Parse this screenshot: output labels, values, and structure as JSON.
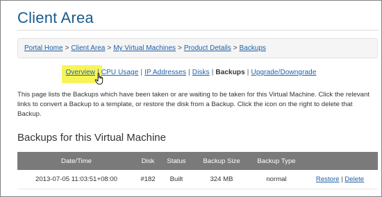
{
  "page_title": "Client Area",
  "breadcrumb": {
    "items": [
      "Portal Home",
      "Client Area",
      "My Virtual Machines",
      "Product Details",
      "Backups"
    ],
    "separator": ">"
  },
  "tabs": {
    "items": [
      "Overview",
      "CPU Usage",
      "IP Addresses",
      "Disks",
      "Backups",
      "Upgrade/Downgrade"
    ],
    "active": "Backups",
    "highlighted": "Overview",
    "separator": "|"
  },
  "intro_text": "This page lists the Backups which have been taken or are waiting to be taken for this Virtual Machine. Click the relevant links to convert a Backup to a template, or restore the disk from a Backup. Click the icon on the right to delete that Backup.",
  "section_title": "Backups for this Virtual Machine",
  "table": {
    "headers": [
      "Date/Time",
      "Disk",
      "Status",
      "Backup Size",
      "Backup Type",
      ""
    ],
    "rows": [
      {
        "datetime": "2013-07-05 11:03:51+08:00",
        "disk": "#182",
        "status": "Built",
        "size": "324 MB",
        "type": "normal",
        "restore_label": "Restore",
        "action_sep": "|",
        "delete_label": "Delete"
      }
    ]
  },
  "colors": {
    "title": "#1a5a8c",
    "link": "#1f5fa8",
    "highlight": "#f7f45a",
    "table_header_bg": "#7a7a7a"
  },
  "icons": {
    "cursor": "hand-pointer-icon"
  }
}
